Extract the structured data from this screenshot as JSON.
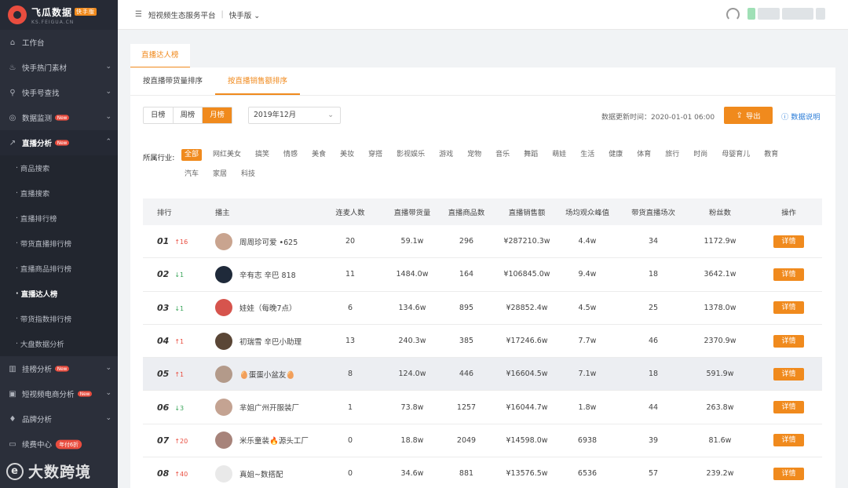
{
  "logo": {
    "name": "飞瓜数据",
    "badge": "快手版",
    "domain": "KS.FEIGUA.CN"
  },
  "sidebar": {
    "items": [
      {
        "label": "工作台",
        "icon": "home-icon"
      },
      {
        "label": "快手热门素材",
        "icon": "fire-icon"
      },
      {
        "label": "快手号查找",
        "icon": "search-icon"
      },
      {
        "label": "数据监测",
        "icon": "monitor-icon",
        "badge": "New"
      },
      {
        "label": "直播分析",
        "icon": "trend-icon",
        "badge": "New"
      }
    ],
    "sub_items": [
      "商品搜索",
      "直播搜索",
      "直播排行榜",
      "带货直播排行榜",
      "直播商品排行榜",
      "直播达人榜",
      "带货指数排行榜",
      "大盘数据分析"
    ],
    "items_after": [
      {
        "label": "挂榜分析",
        "icon": "bar-chart-icon",
        "badge": "New"
      },
      {
        "label": "短视频电商分析",
        "icon": "shop-icon",
        "badge": "New"
      },
      {
        "label": "品牌分析",
        "icon": "diamond-icon"
      },
      {
        "label": "续费中心",
        "icon": "card-icon",
        "badge": "年付6折"
      }
    ],
    "watermark": "大数跨境"
  },
  "topbar": {
    "title": "短视频生态服务平台",
    "separator": "|",
    "version": "快手版"
  },
  "page": {
    "tab": "直播达人榜",
    "subtabs": [
      "按直播带货量排序",
      "按直播销售额排序"
    ],
    "periods": [
      "日榜",
      "周榜",
      "月榜"
    ],
    "month": "2019年12月",
    "update_time": "数据更新时间：2020-01-01 06:00",
    "export": "导出",
    "data_note": "数据说明",
    "industry_label": "所属行业:",
    "industries": [
      "全部",
      "网红美女",
      "搞笑",
      "情感",
      "美食",
      "美妆",
      "穿搭",
      "影视娱乐",
      "游戏",
      "宠物",
      "音乐",
      "舞蹈",
      "萌娃",
      "生活",
      "健康",
      "体育",
      "旅行",
      "时尚",
      "母婴育儿",
      "教育",
      "汽车",
      "家居",
      "科技"
    ]
  },
  "table": {
    "headers": [
      "排行",
      "播主",
      "连麦人数",
      "直播带货量",
      "直播商品数",
      "直播销售额",
      "场均观众峰值",
      "带货直播场次",
      "粉丝数",
      "操作"
    ],
    "detail_label": "详情",
    "rows": [
      {
        "rank": "01",
        "change": "↑16",
        "dir": "up",
        "host": "周周珍可爱 •625",
        "lianmai": "20",
        "volume": "59.1w",
        "goods": "296",
        "sales": "¥287210.3w",
        "peak": "4.4w",
        "sessions": "34",
        "fans": "1172.9w",
        "avatar_color": "#c9a48f"
      },
      {
        "rank": "02",
        "change": "↓1",
        "dir": "down",
        "host": "辛有志 辛巴 818",
        "lianmai": "11",
        "volume": "1484.0w",
        "goods": "164",
        "sales": "¥106845.0w",
        "peak": "9.4w",
        "sessions": "18",
        "fans": "3642.1w",
        "avatar_color": "#1f2a3a"
      },
      {
        "rank": "03",
        "change": "↓1",
        "dir": "down",
        "host": "娃娃（每晚7点）",
        "lianmai": "6",
        "volume": "134.6w",
        "goods": "895",
        "sales": "¥28852.4w",
        "peak": "4.5w",
        "sessions": "25",
        "fans": "1378.0w",
        "avatar_color": "#d6544d"
      },
      {
        "rank": "04",
        "change": "↑1",
        "dir": "up",
        "host": "初瑞雪 辛巴小助理",
        "lianmai": "13",
        "volume": "240.3w",
        "goods": "385",
        "sales": "¥17246.6w",
        "peak": "7.7w",
        "sessions": "46",
        "fans": "2370.9w",
        "avatar_color": "#5a4636"
      },
      {
        "rank": "05",
        "change": "↑1",
        "dir": "up",
        "host": "🥚蛋蛋小盆友🥚",
        "lianmai": "8",
        "volume": "124.0w",
        "goods": "446",
        "sales": "¥16604.5w",
        "peak": "7.1w",
        "sessions": "18",
        "fans": "591.9w",
        "avatar_color": "#b39a8a"
      },
      {
        "rank": "06",
        "change": "↓3",
        "dir": "down",
        "host": "芈姐广州开服装厂",
        "lianmai": "1",
        "volume": "73.8w",
        "goods": "1257",
        "sales": "¥16044.7w",
        "peak": "1.8w",
        "sessions": "44",
        "fans": "263.8w",
        "avatar_color": "#c4a392"
      },
      {
        "rank": "07",
        "change": "↑20",
        "dir": "up",
        "host": "米乐童装🔥源头工厂",
        "lianmai": "0",
        "volume": "18.8w",
        "goods": "2049",
        "sales": "¥14598.0w",
        "peak": "6938",
        "sessions": "39",
        "fans": "81.6w",
        "avatar_color": "#a7837a"
      },
      {
        "rank": "08",
        "change": "↑40",
        "dir": "up",
        "host": "真姐~数搭配",
        "lianmai": "0",
        "volume": "34.6w",
        "goods": "881",
        "sales": "¥13576.5w",
        "peak": "6536",
        "sessions": "57",
        "fans": "239.2w",
        "avatar_color": "#e9e9e9"
      }
    ]
  }
}
